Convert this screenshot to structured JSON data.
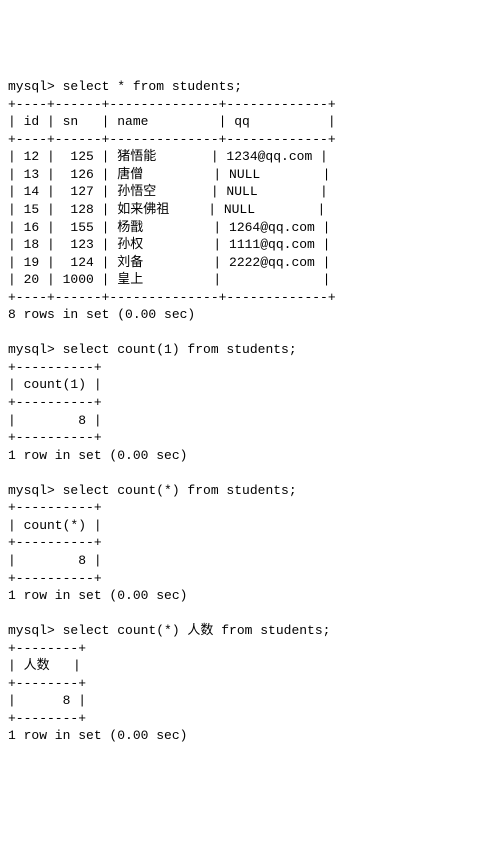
{
  "block1": {
    "prompt": "mysql> ",
    "query": "select * from students;",
    "sep_top": "+----+------+--------------+-------------+",
    "header": "| id | sn   | name         | qq          |",
    "sep_mid": "+----+------+--------------+-------------+",
    "rows": [
      "| 12 |  125 | 猪悟能       | 1234@qq.com |",
      "| 13 |  126 | 唐僧         | NULL        |",
      "| 14 |  127 | 孙悟空       | NULL        |",
      "| 15 |  128 | 如来佛祖     | NULL        |",
      "| 16 |  155 | 杨戬         | 1264@qq.com |",
      "| 18 |  123 | 孙权         | 1111@qq.com |",
      "| 19 |  124 | 刘备         | 2222@qq.com |",
      "| 20 | 1000 | 皇上         |             |"
    ],
    "sep_bot": "+----+------+--------------+-------------+",
    "status": "8 rows in set (0.00 sec)"
  },
  "block2": {
    "prompt": "mysql> ",
    "query": "select count(1) from students;",
    "sep_top": "+----------+",
    "header": "| count(1) |",
    "sep_mid": "+----------+",
    "row": "|        8 |",
    "sep_bot": "+----------+",
    "status": "1 row in set (0.00 sec)"
  },
  "block3": {
    "prompt": "mysql> ",
    "query": "select count(*) from students;",
    "sep_top": "+----------+",
    "header": "| count(*) |",
    "sep_mid": "+----------+",
    "row": "|        8 |",
    "sep_bot": "+----------+",
    "status": "1 row in set (0.00 sec)"
  },
  "block4": {
    "prompt": "mysql> ",
    "query": "select count(*) 人数 from students;",
    "sep_top": "+--------+",
    "header": "| 人数   |",
    "sep_mid": "+--------+",
    "row": "|      8 |",
    "sep_bot": "+--------+",
    "status": "1 row in set (0.00 sec)"
  },
  "chart_data": {
    "type": "table",
    "queries": [
      {
        "sql": "select * from students;",
        "columns": [
          "id",
          "sn",
          "name",
          "qq"
        ],
        "rows": [
          [
            12,
            125,
            "猪悟能",
            "1234@qq.com"
          ],
          [
            13,
            126,
            "唐僧",
            null
          ],
          [
            14,
            127,
            "孙悟空",
            null
          ],
          [
            15,
            128,
            "如来佛祖",
            null
          ],
          [
            16,
            155,
            "杨戬",
            "1264@qq.com"
          ],
          [
            18,
            123,
            "孙权",
            "1111@qq.com"
          ],
          [
            19,
            124,
            "刘备",
            "2222@qq.com"
          ],
          [
            20,
            1000,
            "皇上",
            ""
          ]
        ],
        "status": "8 rows in set (0.00 sec)"
      },
      {
        "sql": "select count(1) from students;",
        "columns": [
          "count(1)"
        ],
        "rows": [
          [
            8
          ]
        ],
        "status": "1 row in set (0.00 sec)"
      },
      {
        "sql": "select count(*) from students;",
        "columns": [
          "count(*)"
        ],
        "rows": [
          [
            8
          ]
        ],
        "status": "1 row in set (0.00 sec)"
      },
      {
        "sql": "select count(*) 人数 from students;",
        "columns": [
          "人数"
        ],
        "rows": [
          [
            8
          ]
        ],
        "status": "1 row in set (0.00 sec)"
      }
    ]
  }
}
